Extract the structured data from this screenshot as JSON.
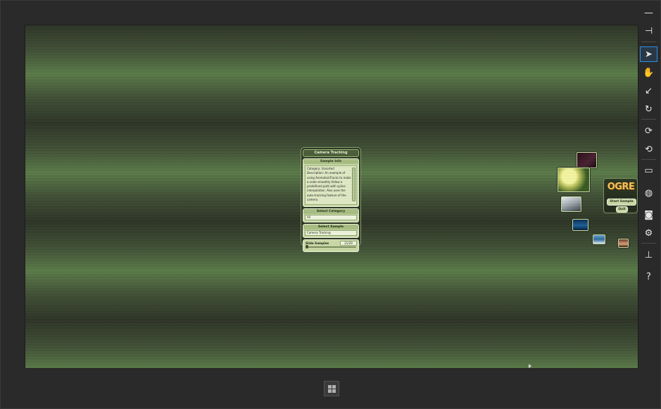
{
  "panel": {
    "title": "Camera Tracking",
    "info_header": "Sample Info",
    "info_text": "Category: Unsorted\nDescription: An example of using AnimationTracks to make a node smoothly follow a predefined path with spline interpolation. Also uses the auto-tracking feature of the camera.",
    "category_header": "Select Category",
    "category_value": "All",
    "sample_header": "Select Sample",
    "sample_value": "Camera Tracking",
    "slider_label": "Slide Samples",
    "slider_value": "21/29",
    "slider_fraction": 0.0
  },
  "carousel": {
    "logo": "OGRE",
    "start_button": "Start Sample",
    "quit_button": "Quit"
  },
  "toolbar": {
    "minimize": "—",
    "pin": "⊣",
    "select": "➤",
    "pan": "✋",
    "zoom": "↙",
    "rotate": "↻",
    "rotate_cw": "⟳",
    "rotate_ccw": "⟲",
    "display": "▭",
    "globe": "◍",
    "camera": "◙",
    "settings": "⚙",
    "network": "⊥",
    "help": "?"
  },
  "icons": {
    "windows_logo": "windows-icon"
  },
  "colors": {
    "accent": "#2f8fe6",
    "panel_bg": "#c9d8a6",
    "logo": "#f3c35a"
  }
}
